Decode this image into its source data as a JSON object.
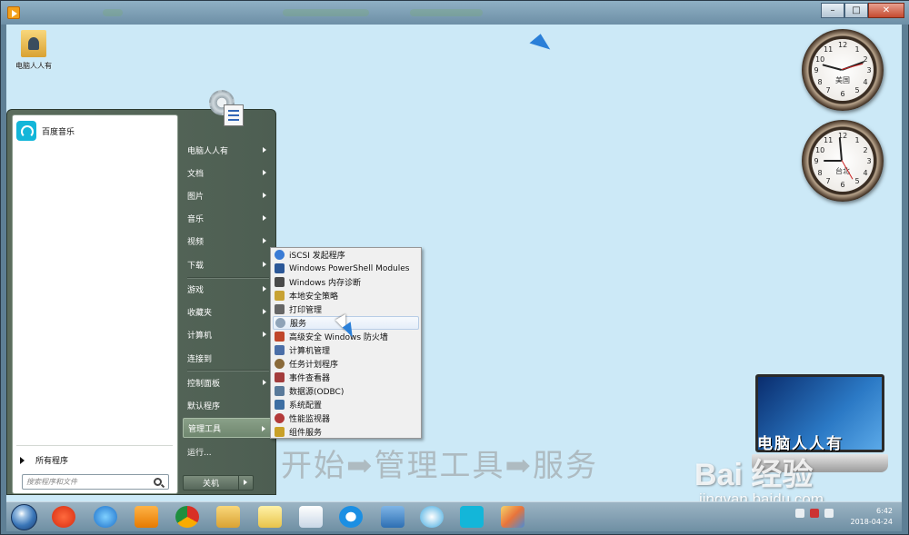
{
  "desktop": {
    "icons": [
      {
        "label": "电脑人人有"
      }
    ],
    "clocks": [
      {
        "city": "美国",
        "numbers": [
          "12",
          "1",
          "2",
          "3",
          "4",
          "5",
          "6",
          "7",
          "8",
          "9",
          "10",
          "11"
        ]
      },
      {
        "city": "台北",
        "numbers": [
          "12",
          "1",
          "2",
          "3",
          "4",
          "5",
          "6",
          "7",
          "8",
          "9",
          "10",
          "11"
        ]
      }
    ],
    "caption": "开始➡管理工具➡服务",
    "laptop_text": "电脑人人有",
    "watermark": "Bai 经验",
    "watermark_url": "jingyan.baidu.com"
  },
  "start_menu": {
    "pinned": [
      {
        "label": "百度音乐",
        "icon": "music-icon"
      }
    ],
    "all_programs": "所有程序",
    "search_placeholder": "搜索程序和文件",
    "right_items": [
      {
        "label": "电脑人人有",
        "submenu": true
      },
      {
        "label": "文档",
        "submenu": true
      },
      {
        "label": "图片",
        "submenu": true
      },
      {
        "label": "音乐",
        "submenu": true
      },
      {
        "label": "视频",
        "submenu": true
      },
      {
        "label": "下载",
        "submenu": true
      },
      {
        "label": "游戏",
        "submenu": true
      },
      {
        "label": "收藏夹",
        "submenu": true
      },
      {
        "label": "计算机",
        "submenu": true
      },
      {
        "label": "连接到",
        "submenu": false
      },
      {
        "label": "控制面板",
        "submenu": true
      },
      {
        "label": "默认程序",
        "submenu": false
      },
      {
        "label": "管理工具",
        "submenu": true
      },
      {
        "label": "运行...",
        "submenu": false
      }
    ],
    "shutdown": "关机"
  },
  "admin_tools": {
    "items": [
      {
        "label": "iSCSI 发起程序",
        "color": "#3a7bd5"
      },
      {
        "label": "Windows PowerShell Modules",
        "color": "#2b5797"
      },
      {
        "label": "Windows 内存诊断",
        "color": "#4a4a4a"
      },
      {
        "label": "本地安全策略",
        "color": "#c8a233"
      },
      {
        "label": "打印管理",
        "color": "#666666"
      },
      {
        "label": "服务",
        "color": "#8fa3b8"
      },
      {
        "label": "高级安全 Windows 防火墙",
        "color": "#c0462a"
      },
      {
        "label": "计算机管理",
        "color": "#4b6fa8"
      },
      {
        "label": "任务计划程序",
        "color": "#8a6a3a"
      },
      {
        "label": "事件查看器",
        "color": "#a33c3c"
      },
      {
        "label": "数据源(ODBC)",
        "color": "#5a7a9a"
      },
      {
        "label": "系统配置",
        "color": "#3e6fa3"
      },
      {
        "label": "性能监视器",
        "color": "#b33939"
      },
      {
        "label": "组件服务",
        "color": "#c9a028"
      }
    ],
    "hover_index": 5
  },
  "taskbar": {
    "time": "6:42",
    "date": "2018-04-24"
  },
  "colors": {
    "desktop_bg": "#cce9f7",
    "menu_bg": "#55665a",
    "accent": "#2a7fd8"
  }
}
